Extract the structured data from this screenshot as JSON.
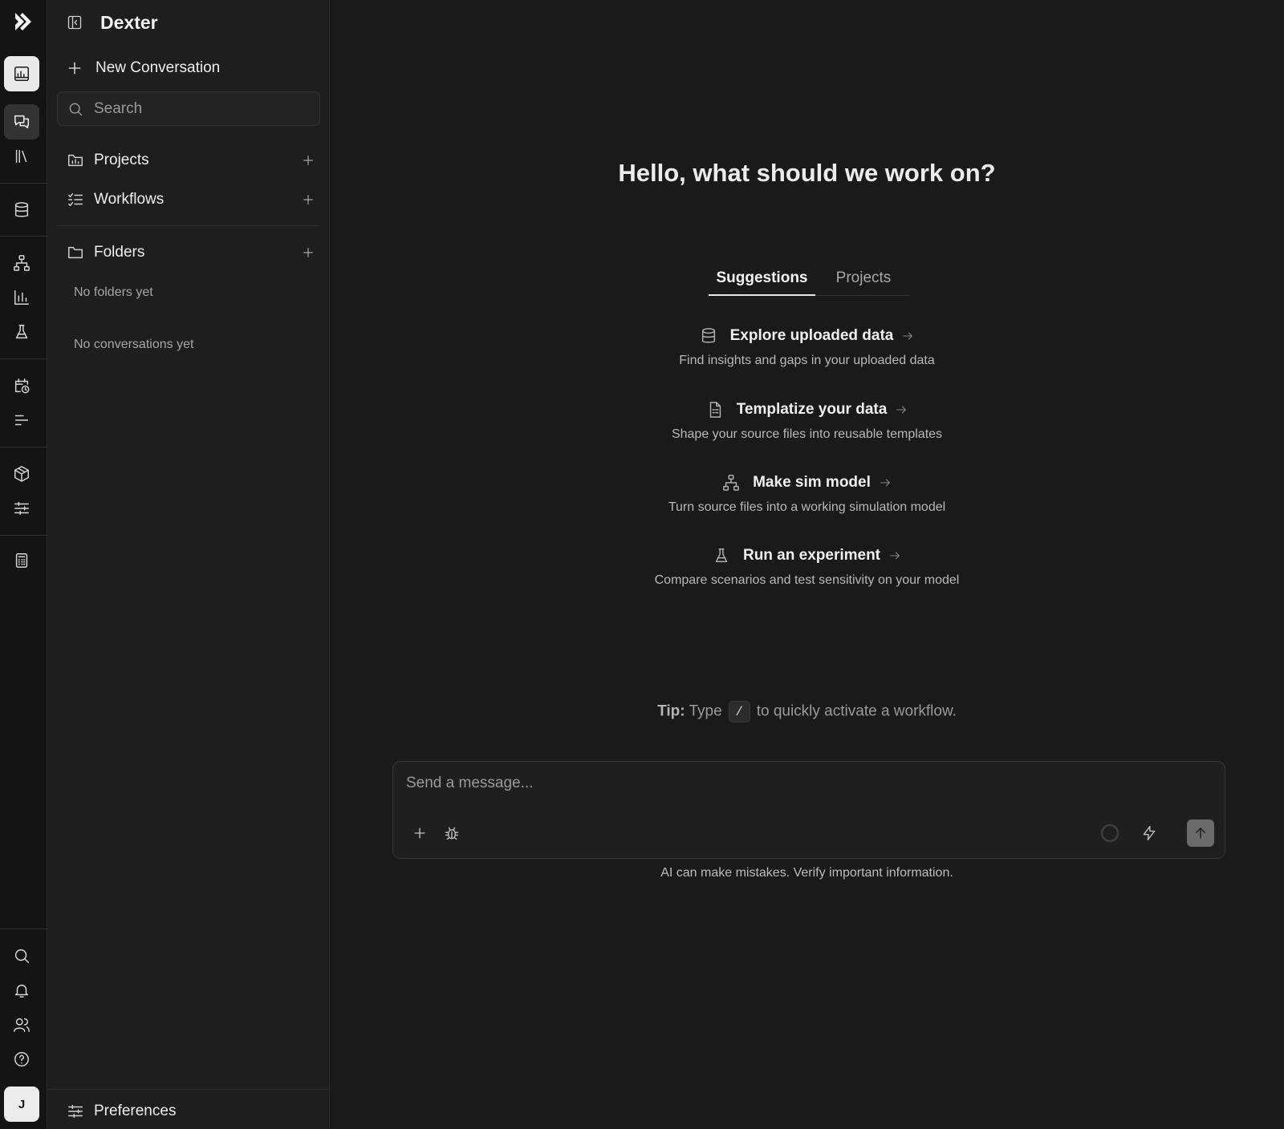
{
  "app": {
    "title": "Dexter",
    "brand_color": "#ffffff"
  },
  "rail": {
    "top_items": [
      "dashboard-icon",
      "chat-icon",
      "library-icon",
      "database-icon",
      "hierarchy-icon",
      "bar-chart-icon",
      "flask-icon",
      "calendar-clock-icon",
      "list-filter-icon",
      "package-icon",
      "sliders-icon",
      "calculator-icon"
    ],
    "bottom_items": [
      "search-icon",
      "bell-icon",
      "users-icon",
      "help-icon"
    ],
    "avatar_initial": "J"
  },
  "sidebar": {
    "title": "Dexter",
    "new_conversation": "New Conversation",
    "search_placeholder": "Search",
    "sections": {
      "projects": "Projects",
      "workflows": "Workflows",
      "folders": "Folders"
    },
    "no_folders": "No folders yet",
    "no_conversations": "No conversations yet",
    "preferences": "Preferences"
  },
  "main": {
    "greeting": "Hello, what should we work on?",
    "tabs": {
      "suggestions": "Suggestions",
      "projects": "Projects",
      "active": "Suggestions"
    },
    "suggestions": [
      {
        "title": "Explore uploaded data",
        "description": "Find insights and gaps in your uploaded data",
        "icon": "database-icon"
      },
      {
        "title": "Templatize your data",
        "description": "Shape your source files into reusable templates",
        "icon": "document-icon"
      },
      {
        "title": "Make sim model",
        "description": "Turn source files into a working simulation model",
        "icon": "hierarchy-icon"
      },
      {
        "title": "Run an experiment",
        "description": "Compare scenarios and test sensitivity on your model",
        "icon": "flask-icon"
      }
    ],
    "tip": {
      "label": "Tip:",
      "before": "Type",
      "key": "/",
      "after": "to quickly activate a workflow."
    },
    "composer": {
      "placeholder": "Send a message..."
    },
    "disclaimer": "AI can make mistakes. Verify important information."
  }
}
